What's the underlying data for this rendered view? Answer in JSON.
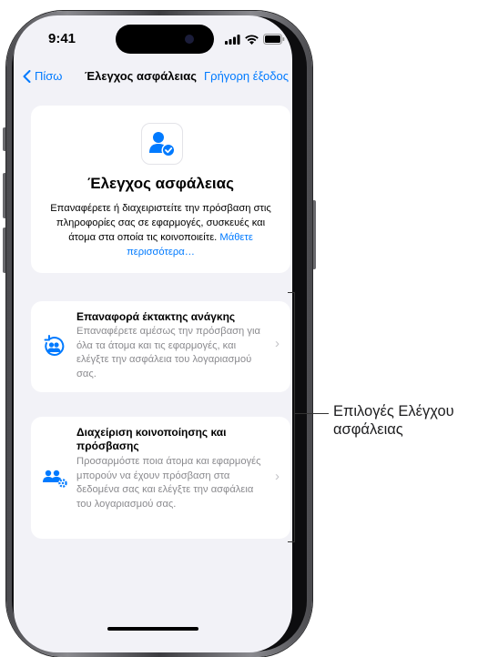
{
  "status_bar": {
    "time": "9:41"
  },
  "nav": {
    "back_label": "Πίσω",
    "title": "Έλεγχος ασφάλειας",
    "quick_exit_label": "Γρήγορη έξοδος"
  },
  "hero": {
    "title": "Έλεγχος ασφάλειας",
    "description": "Επαναφέρετε ή διαχειριστείτε την πρόσβαση στις πληροφορίες σας σε εφαρμογές, συσκευές και άτομα στα οποία τις κοινοποιείτε.",
    "link_label": "Μάθετε περισσότερα…"
  },
  "options": [
    {
      "title": "Επαναφορά έκτακτης ανάγκης",
      "description": "Επαναφέρετε αμέσως την πρόσβαση για όλα τα άτομα και τις εφαρμογές, και ελέγξτε την ασφάλεια του λογαριασμού σας."
    },
    {
      "title": "Διαχείριση κοινοποίησης και πρόσβασης",
      "description": "Προσαρμόστε ποια άτομα και εφαρμογές μπορούν να έχουν πρόσβαση στα δεδομένα σας και ελέγξτε την ασφάλεια του λογαριασμού σας."
    }
  ],
  "callout": {
    "label": "Επιλογές Ελέγχου ασφάλειας"
  },
  "colors": {
    "accent": "#007aff",
    "background": "#f2f2f7",
    "secondary_text": "#8a8a8e"
  }
}
